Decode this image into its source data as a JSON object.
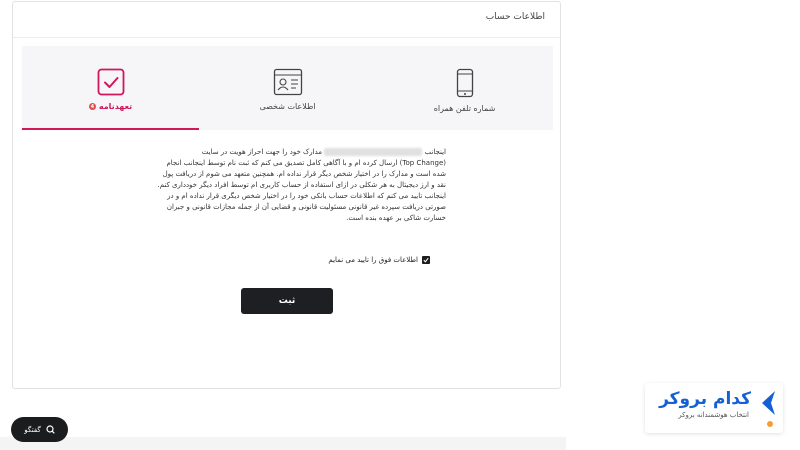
{
  "card": {
    "title": "اطلاعات حساب"
  },
  "steps": [
    {
      "label": "شماره تلفن همراه",
      "icon": "mobile-phone-icon",
      "active": false
    },
    {
      "label": "اطلاعات شخصی",
      "icon": "id-card-icon",
      "active": false
    },
    {
      "label": "تعهدنامه",
      "icon": "checkbox-check-icon",
      "active": true,
      "badge": "4"
    }
  ],
  "colors": {
    "accent": "#d0175a",
    "dark": "#1e1f22",
    "brand": "#1560d6",
    "badge": "#e34b4b"
  },
  "agreement": {
    "line1_start": "اینجانب",
    "line1_end": "مدارک خود را جهت احراز هویت در سایت",
    "line2": "(Top Change) ارسال کرده ام و با آگاهی کامل تصدیق می کنم که ثبت نام توسط اینجانب انجام",
    "line3": "شده است و مدارک را در اختیار شخص دیگر قرار نداده ام. همچنین متعهد می شوم از دریافت پول",
    "line4": "نقد و ارز دیجیتال به هر شکلی در ازای استفاده از حساب کاربری ام توسط افراد دیگر خودداری کنم.",
    "line5": "اینجانب تایید می کنم که اطلاعات حساب بانکی خود را در اختیار شخص دیگری قرار نداده ام و در",
    "line6": "صورتی دریافت سپرده غیر قانونی مسئولیت قانونی و قضایی آن از جمله مجازات قانونی و جبران",
    "line7": "خسارت شاکی بر عهده بنده است."
  },
  "confirm": {
    "label": "اطلاعات فوق را تایید می نمایم",
    "checked": true
  },
  "submit": {
    "label": "ثبت"
  },
  "chat": {
    "label": "گفتگو"
  },
  "brand": {
    "name": "کدام بروکر",
    "tagline": "انتخاب هوشمندانه بروکر"
  }
}
